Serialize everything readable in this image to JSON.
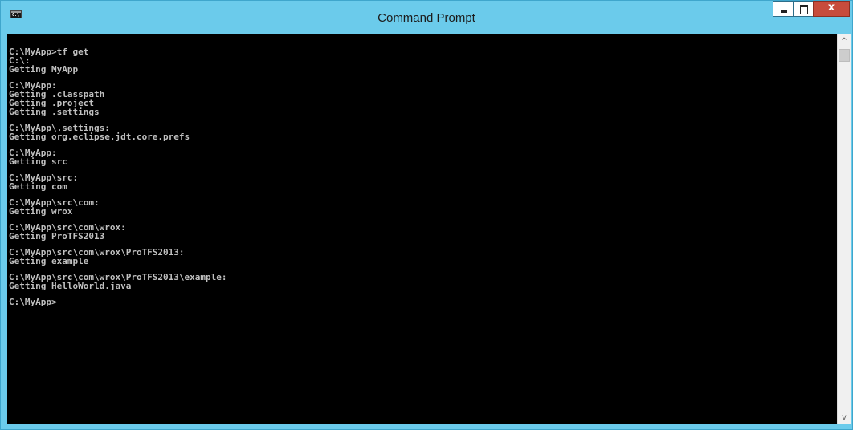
{
  "window": {
    "title": "Command Prompt",
    "app_icon_text": "C:\\",
    "close_glyph": "x",
    "icons": {
      "app": "console-app-icon",
      "minimize": "minimize-icon",
      "maximize": "maximize-icon",
      "close": "close-icon",
      "scroll_up": "scroll-up-arrow-icon",
      "scroll_down": "scroll-down-arrow-icon"
    },
    "colors": {
      "titlebar": "#6bcbeb",
      "console_bg": "#000000",
      "console_text": "#c0c0c0",
      "close_button": "#c74c3c"
    }
  },
  "console": {
    "blocks": [
      [
        "C:\\MyApp>tf get",
        "C:\\:",
        "Getting MyApp"
      ],
      [
        "C:\\MyApp:",
        "Getting .classpath",
        "Getting .project",
        "Getting .settings"
      ],
      [
        "C:\\MyApp\\.settings:",
        "Getting org.eclipse.jdt.core.prefs"
      ],
      [
        "C:\\MyApp:",
        "Getting src"
      ],
      [
        "C:\\MyApp\\src:",
        "Getting com"
      ],
      [
        "C:\\MyApp\\src\\com:",
        "Getting wrox"
      ],
      [
        "C:\\MyApp\\src\\com\\wrox:",
        "Getting ProTFS2013"
      ],
      [
        "C:\\MyApp\\src\\com\\wrox\\ProTFS2013:",
        "Getting example"
      ],
      [
        "C:\\MyApp\\src\\com\\wrox\\ProTFS2013\\example:",
        "Getting HelloWorld.java"
      ],
      [
        "C:\\MyApp>"
      ]
    ]
  },
  "scrollbar": {
    "up_glyph": "^",
    "down_glyph": "v"
  }
}
